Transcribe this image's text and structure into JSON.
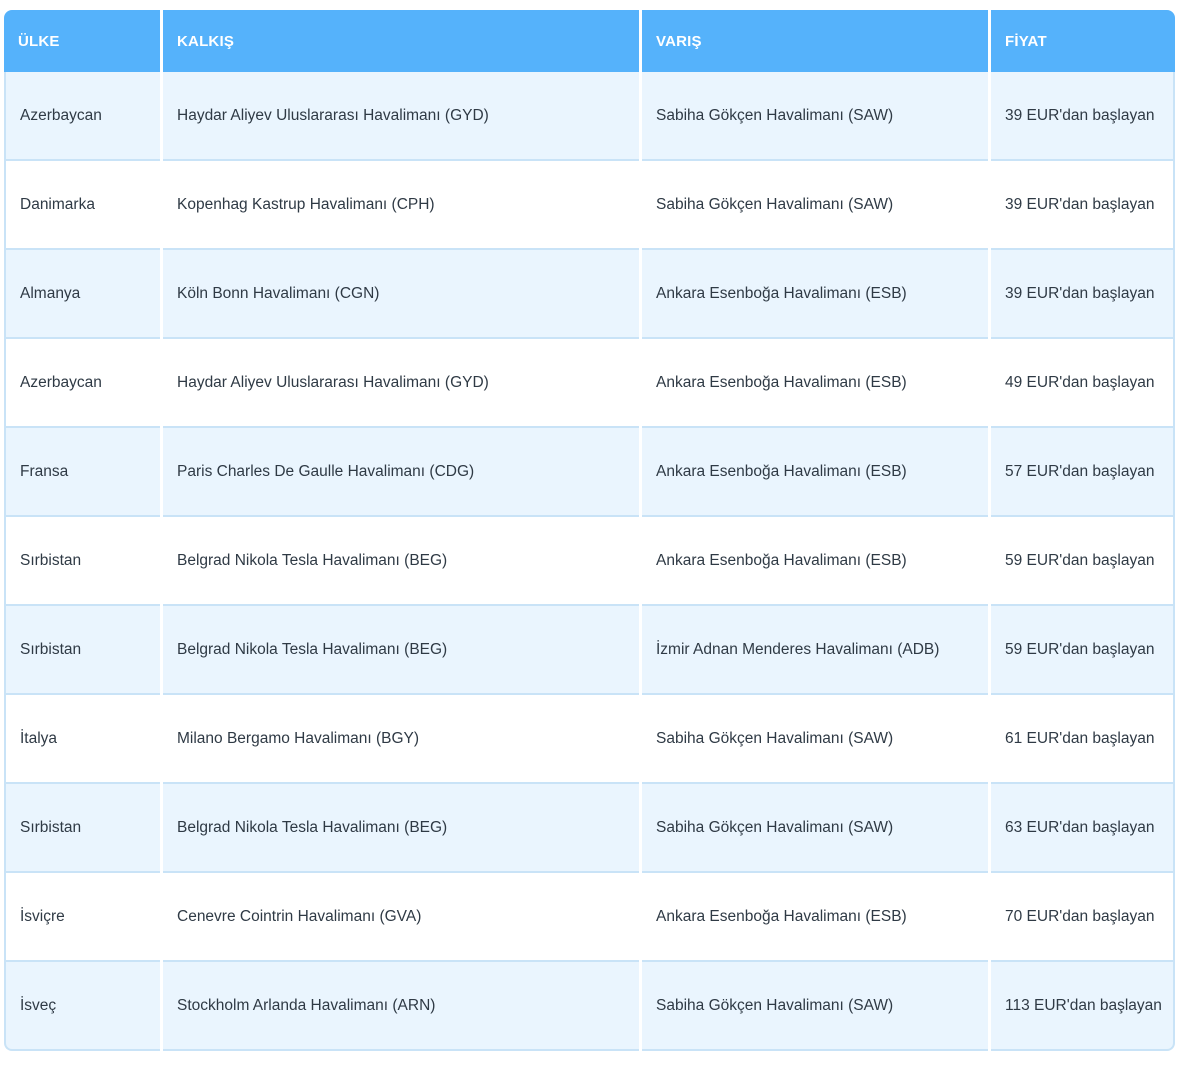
{
  "headers": {
    "country": "ÜLKE",
    "departure": "KALKIŞ",
    "arrival": "VARIŞ",
    "price": "FİYAT"
  },
  "rows": [
    {
      "country": "Azerbaycan",
      "departure": "Haydar Aliyev Uluslararası Havalimanı (GYD)",
      "arrival": "Sabiha Gökçen Havalimanı (SAW)",
      "price": "39 EUR'dan başlayan"
    },
    {
      "country": "Danimarka",
      "departure": "Kopenhag Kastrup Havalimanı (CPH)",
      "arrival": "Sabiha Gökçen Havalimanı (SAW)",
      "price": "39 EUR'dan başlayan"
    },
    {
      "country": "Almanya",
      "departure": "Köln Bonn Havalimanı (CGN)",
      "arrival": "Ankara Esenboğa Havalimanı (ESB)",
      "price": "39 EUR'dan başlayan"
    },
    {
      "country": "Azerbaycan",
      "departure": "Haydar Aliyev Uluslararası Havalimanı (GYD)",
      "arrival": "Ankara Esenboğa Havalimanı (ESB)",
      "price": "49 EUR'dan başlayan"
    },
    {
      "country": "Fransa",
      "departure": "Paris Charles De Gaulle Havalimanı (CDG)",
      "arrival": "Ankara Esenboğa Havalimanı (ESB)",
      "price": "57 EUR'dan başlayan"
    },
    {
      "country": "Sırbistan",
      "departure": "Belgrad Nikola Tesla Havalimanı (BEG)",
      "arrival": "Ankara Esenboğa Havalimanı (ESB)",
      "price": "59 EUR'dan başlayan"
    },
    {
      "country": "Sırbistan",
      "departure": "Belgrad Nikola Tesla Havalimanı (BEG)",
      "arrival": "İzmir Adnan Menderes Havalimanı (ADB)",
      "price": "59 EUR'dan başlayan"
    },
    {
      "country": "İtalya",
      "departure": "Milano Bergamo Havalimanı (BGY)",
      "arrival": "Sabiha Gökçen Havalimanı (SAW)",
      "price": "61 EUR'dan başlayan"
    },
    {
      "country": "Sırbistan",
      "departure": "Belgrad Nikola Tesla Havalimanı (BEG)",
      "arrival": "Sabiha Gökçen Havalimanı (SAW)",
      "price": "63 EUR'dan başlayan"
    },
    {
      "country": "İsviçre",
      "departure": "Cenevre Cointrin Havalimanı (GVA)",
      "arrival": "Ankara Esenboğa Havalimanı (ESB)",
      "price": "70 EUR'dan başlayan"
    },
    {
      "country": "İsveç",
      "departure": "Stockholm Arlanda Havalimanı (ARN)",
      "arrival": "Sabiha Gökçen Havalimanı (SAW)",
      "price": "113 EUR'dan başlayan"
    }
  ],
  "colors": {
    "header_bg": "#55b2fb",
    "row_alt_bg": "#eaf5fe",
    "border": "#c9e3f7",
    "text": "#2f3a45"
  }
}
